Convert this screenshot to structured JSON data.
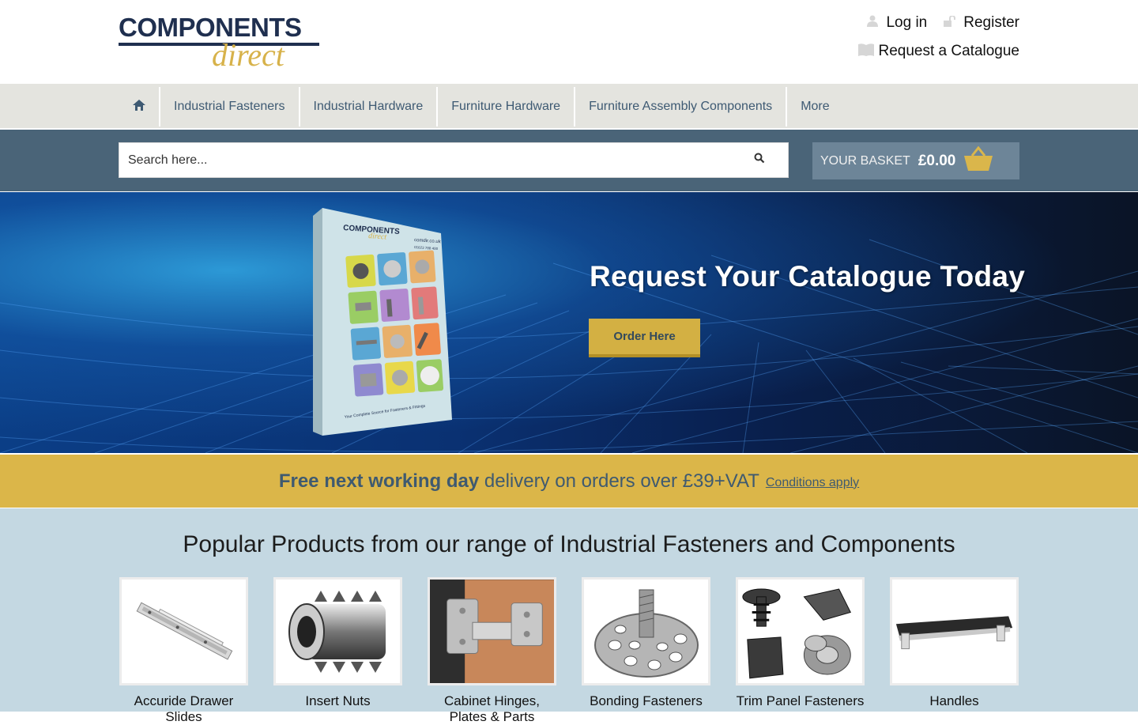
{
  "header": {
    "logo_top": "COMPONENTS",
    "logo_bottom": "direct",
    "login_label": "Log in",
    "register_label": "Register",
    "catalogue_label": "Request a Catalogue"
  },
  "nav": {
    "home_icon": "home-icon",
    "items": [
      "Industrial Fasteners",
      "Industrial Hardware",
      "Furniture Hardware",
      "Furniture Assembly Components",
      "More"
    ]
  },
  "search": {
    "placeholder": "Search here...",
    "icon": "search-icon"
  },
  "basket": {
    "label": "YOUR BASKET",
    "amount": "£0.00",
    "icon": "basket-icon"
  },
  "hero": {
    "title": "Request Your Catalogue Today",
    "button": "Order Here",
    "catalogue_brand_top": "COMPONENTS",
    "catalogue_brand_bottom": "direct",
    "catalogue_url": "comdir.co.uk",
    "catalogue_phone": "01623 788 400",
    "catalogue_tagline": "Your Complete Source for Fasteners & Fittings"
  },
  "delivery": {
    "bold": "Free next working day",
    "rest": " delivery on orders over £39+VAT",
    "conditions": "Conditions apply"
  },
  "popular": {
    "title": "Popular Products from our range of Industrial Fasteners and Components",
    "products": [
      {
        "name": "Accuride Drawer Slides"
      },
      {
        "name": "Insert Nuts"
      },
      {
        "name": "Cabinet Hinges, Plates & Parts"
      },
      {
        "name": "Bonding Fasteners"
      },
      {
        "name": "Trim Panel Fasteners"
      },
      {
        "name": "Handles"
      }
    ]
  },
  "colors": {
    "navy": "#1f2f4f",
    "gold": "#d7b24a",
    "nav_text": "#3e5a73",
    "search_band": "#4a6478",
    "basket_bg": "#6d8598",
    "delivery_bg": "#dbb649",
    "popular_bg": "#c4d8e2"
  }
}
